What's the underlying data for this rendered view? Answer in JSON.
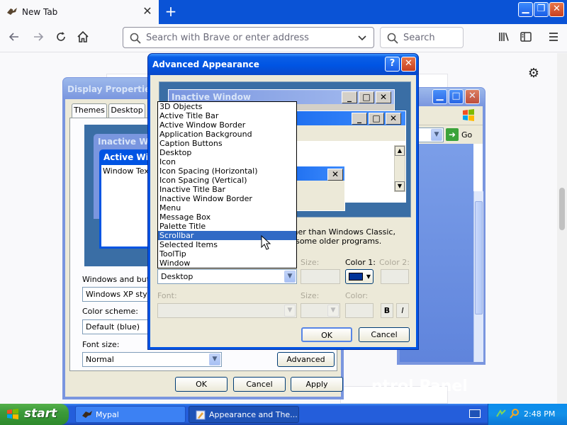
{
  "browser": {
    "tab_title": "New Tab",
    "tab_close": "✕",
    "new_tab": "+",
    "url_placeholder": "Search with Brave or enter address",
    "search_placeholder": "Search"
  },
  "display_properties": {
    "title": "Display Properties",
    "tabs": [
      "Themes",
      "Desktop"
    ],
    "preview": {
      "inactive_title": "Inactive Window",
      "active_title": "Active Window",
      "window_text": "Window Text"
    },
    "windows_buttons_label": "Windows and buttons:",
    "windows_buttons_value": "Windows XP style",
    "color_scheme_label": "Color scheme:",
    "color_scheme_value": "Default (blue)",
    "font_size_label": "Font size:",
    "font_size_value": "Normal",
    "advanced_button": "Advanced",
    "ok": "OK",
    "cancel": "Cancel",
    "apply": "Apply"
  },
  "control_panel": {
    "go_label": "Go",
    "footer_text": "ntrol Panel"
  },
  "advanced_appearance": {
    "title": "Advanced Appearance",
    "help_button": "?",
    "close_button": "✕",
    "preview": {
      "inactive_title": "Inactive Window",
      "message_fragment": "ing other than Windows Classic,",
      "message_fragment2": "ept in some older programs."
    },
    "item_list": [
      "3D Objects",
      "Active Title Bar",
      "Active Window Border",
      "Application Background",
      "Caption Buttons",
      "Desktop",
      "Icon",
      "Icon Spacing (Horizontal)",
      "Icon Spacing (Vertical)",
      "Inactive Title Bar",
      "Inactive Window Border",
      "Menu",
      "Message Box",
      "Palette Title",
      "Scrollbar",
      "Selected Items",
      "ToolTip",
      "Window"
    ],
    "selected_list_item": "Scrollbar",
    "item_combo_value": "Desktop",
    "size_label": "Size:",
    "color1_label": "Color 1:",
    "color2_label": "Color 2:",
    "font_label": "Font:",
    "font_size_label": "Size:",
    "font_color_label": "Color:",
    "bold_label": "B",
    "italic_label": "I",
    "ok": "OK",
    "cancel": "Cancel",
    "color1_swatch": "#003399"
  },
  "taskbar": {
    "start_label": "start",
    "tasks": [
      "Mypal",
      "Appearance and The..."
    ],
    "clock": "2:48 PM"
  }
}
